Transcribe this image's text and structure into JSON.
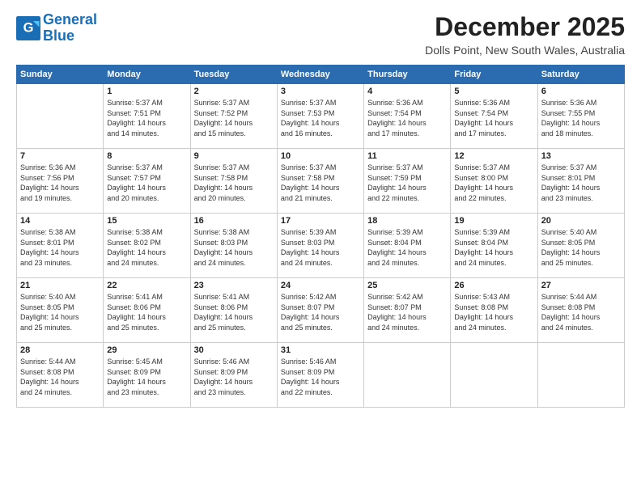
{
  "logo": {
    "line1": "General",
    "line2": "Blue"
  },
  "title": "December 2025",
  "subtitle": "Dolls Point, New South Wales, Australia",
  "days_header": [
    "Sunday",
    "Monday",
    "Tuesday",
    "Wednesday",
    "Thursday",
    "Friday",
    "Saturday"
  ],
  "weeks": [
    [
      {
        "day": "",
        "info": ""
      },
      {
        "day": "1",
        "info": "Sunrise: 5:37 AM\nSunset: 7:51 PM\nDaylight: 14 hours\nand 14 minutes."
      },
      {
        "day": "2",
        "info": "Sunrise: 5:37 AM\nSunset: 7:52 PM\nDaylight: 14 hours\nand 15 minutes."
      },
      {
        "day": "3",
        "info": "Sunrise: 5:37 AM\nSunset: 7:53 PM\nDaylight: 14 hours\nand 16 minutes."
      },
      {
        "day": "4",
        "info": "Sunrise: 5:36 AM\nSunset: 7:54 PM\nDaylight: 14 hours\nand 17 minutes."
      },
      {
        "day": "5",
        "info": "Sunrise: 5:36 AM\nSunset: 7:54 PM\nDaylight: 14 hours\nand 17 minutes."
      },
      {
        "day": "6",
        "info": "Sunrise: 5:36 AM\nSunset: 7:55 PM\nDaylight: 14 hours\nand 18 minutes."
      }
    ],
    [
      {
        "day": "7",
        "info": "Sunrise: 5:36 AM\nSunset: 7:56 PM\nDaylight: 14 hours\nand 19 minutes."
      },
      {
        "day": "8",
        "info": "Sunrise: 5:37 AM\nSunset: 7:57 PM\nDaylight: 14 hours\nand 20 minutes."
      },
      {
        "day": "9",
        "info": "Sunrise: 5:37 AM\nSunset: 7:58 PM\nDaylight: 14 hours\nand 20 minutes."
      },
      {
        "day": "10",
        "info": "Sunrise: 5:37 AM\nSunset: 7:58 PM\nDaylight: 14 hours\nand 21 minutes."
      },
      {
        "day": "11",
        "info": "Sunrise: 5:37 AM\nSunset: 7:59 PM\nDaylight: 14 hours\nand 22 minutes."
      },
      {
        "day": "12",
        "info": "Sunrise: 5:37 AM\nSunset: 8:00 PM\nDaylight: 14 hours\nand 22 minutes."
      },
      {
        "day": "13",
        "info": "Sunrise: 5:37 AM\nSunset: 8:01 PM\nDaylight: 14 hours\nand 23 minutes."
      }
    ],
    [
      {
        "day": "14",
        "info": "Sunrise: 5:38 AM\nSunset: 8:01 PM\nDaylight: 14 hours\nand 23 minutes."
      },
      {
        "day": "15",
        "info": "Sunrise: 5:38 AM\nSunset: 8:02 PM\nDaylight: 14 hours\nand 24 minutes."
      },
      {
        "day": "16",
        "info": "Sunrise: 5:38 AM\nSunset: 8:03 PM\nDaylight: 14 hours\nand 24 minutes."
      },
      {
        "day": "17",
        "info": "Sunrise: 5:39 AM\nSunset: 8:03 PM\nDaylight: 14 hours\nand 24 minutes."
      },
      {
        "day": "18",
        "info": "Sunrise: 5:39 AM\nSunset: 8:04 PM\nDaylight: 14 hours\nand 24 minutes."
      },
      {
        "day": "19",
        "info": "Sunrise: 5:39 AM\nSunset: 8:04 PM\nDaylight: 14 hours\nand 24 minutes."
      },
      {
        "day": "20",
        "info": "Sunrise: 5:40 AM\nSunset: 8:05 PM\nDaylight: 14 hours\nand 25 minutes."
      }
    ],
    [
      {
        "day": "21",
        "info": "Sunrise: 5:40 AM\nSunset: 8:05 PM\nDaylight: 14 hours\nand 25 minutes."
      },
      {
        "day": "22",
        "info": "Sunrise: 5:41 AM\nSunset: 8:06 PM\nDaylight: 14 hours\nand 25 minutes."
      },
      {
        "day": "23",
        "info": "Sunrise: 5:41 AM\nSunset: 8:06 PM\nDaylight: 14 hours\nand 25 minutes."
      },
      {
        "day": "24",
        "info": "Sunrise: 5:42 AM\nSunset: 8:07 PM\nDaylight: 14 hours\nand 25 minutes."
      },
      {
        "day": "25",
        "info": "Sunrise: 5:42 AM\nSunset: 8:07 PM\nDaylight: 14 hours\nand 24 minutes."
      },
      {
        "day": "26",
        "info": "Sunrise: 5:43 AM\nSunset: 8:08 PM\nDaylight: 14 hours\nand 24 minutes."
      },
      {
        "day": "27",
        "info": "Sunrise: 5:44 AM\nSunset: 8:08 PM\nDaylight: 14 hours\nand 24 minutes."
      }
    ],
    [
      {
        "day": "28",
        "info": "Sunrise: 5:44 AM\nSunset: 8:08 PM\nDaylight: 14 hours\nand 24 minutes."
      },
      {
        "day": "29",
        "info": "Sunrise: 5:45 AM\nSunset: 8:09 PM\nDaylight: 14 hours\nand 23 minutes."
      },
      {
        "day": "30",
        "info": "Sunrise: 5:46 AM\nSunset: 8:09 PM\nDaylight: 14 hours\nand 23 minutes."
      },
      {
        "day": "31",
        "info": "Sunrise: 5:46 AM\nSunset: 8:09 PM\nDaylight: 14 hours\nand 22 minutes."
      },
      {
        "day": "",
        "info": ""
      },
      {
        "day": "",
        "info": ""
      },
      {
        "day": "",
        "info": ""
      }
    ]
  ]
}
